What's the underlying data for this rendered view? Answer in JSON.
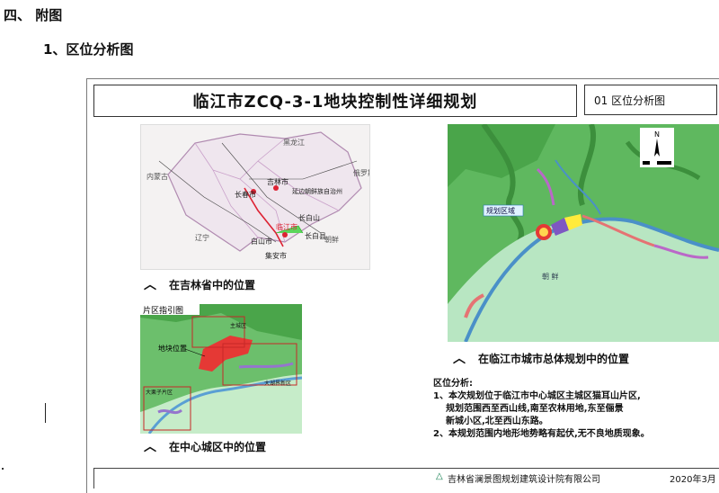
{
  "doc": {
    "heading": "四、  附图",
    "subheading": "1、区位分析图"
  },
  "sheet": {
    "title": "临江市ZCQ-3-1地块控制性详细规划",
    "number_label": "01  区位分析图",
    "captions": {
      "province": "在吉林省中的位置",
      "city": "在临江市城市总体规划中的位置",
      "center": "在中心城区中的位置"
    },
    "caret": "︿",
    "province_labels": [
      "黑龙江",
      "内蒙古",
      "俄罗斯",
      "辽宁",
      "朝鲜",
      "长春市",
      "吉林市",
      "延边朝鲜族自治州",
      "白山市",
      "长白山",
      "临江市",
      "长白县",
      "集安市"
    ],
    "city_labels": {
      "zone": "规划区域",
      "korea": "朝 鲜"
    },
    "center_map": {
      "title": "片区指引图",
      "site": "地块位置",
      "area_a": "主城区",
      "area_b": "大湖界新区",
      "area_c": "大栗子片区"
    },
    "compass_letter": "N",
    "analysis": {
      "title": "区位分析:",
      "lines": [
        "1、本次规划位于临江市中心城区主城区猫耳山片区,",
        "   规划范围西至西山线,南至农林用地,东至俪景",
        "   新城小区,北至西山东路。",
        "2、本规划范围内地形地势略有起伏,无不良地质现象。"
      ]
    },
    "footer": {
      "company": "吉林省澜景图规划建筑设计院有限公司",
      "date": "2020年3月"
    }
  },
  "colors": {
    "water": "#5a9fd4",
    "terrain": "#5ab45a",
    "site": "#e03030",
    "land": "#bde8c4"
  }
}
